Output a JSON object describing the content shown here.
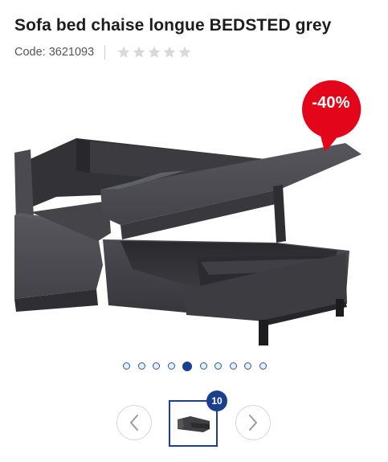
{
  "product": {
    "title": "Sofa bed chaise longue BEDSTED grey",
    "code_label": "Code: 3621093",
    "rating": 0,
    "rating_max": 5
  },
  "discount_badge": "-40%",
  "gallery": {
    "active_index": 5,
    "image_count": 10,
    "count_label": "10",
    "icons": {
      "prev": "chevron-left-icon",
      "next": "chevron-right-icon",
      "star": "star-icon"
    }
  },
  "colors": {
    "badge": "#e3061a",
    "brand_blue": "#1b3f8f",
    "star_empty": "#d9d9d9",
    "sofa": "#3f3f44"
  }
}
